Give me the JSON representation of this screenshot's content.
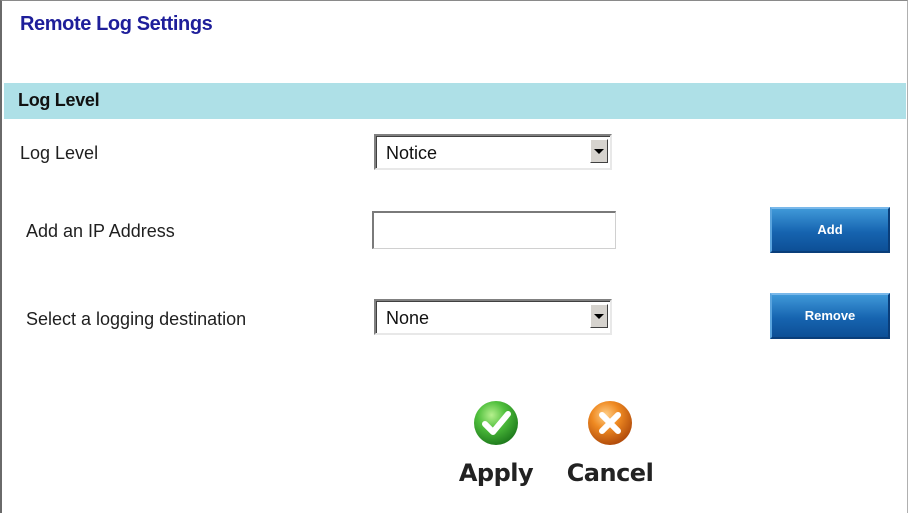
{
  "page": {
    "title": "Remote Log Settings"
  },
  "section": {
    "title": "Log Level"
  },
  "log_level": {
    "label": "Log Level",
    "selected": "Notice"
  },
  "ip_address": {
    "label": "Add an IP Address",
    "value": ""
  },
  "destination": {
    "label": "Select a logging destination",
    "selected": "None"
  },
  "buttons": {
    "add": "Add",
    "remove": "Remove",
    "apply": "Apply",
    "cancel": "Cancel"
  },
  "icons": {
    "apply": "check-icon",
    "cancel": "x-icon"
  },
  "colors": {
    "title": "#1e1e9a",
    "section_bar": "#aee0e7",
    "button": "#1664b0",
    "apply_icon": "#3fa83a",
    "cancel_icon": "#e07818"
  }
}
